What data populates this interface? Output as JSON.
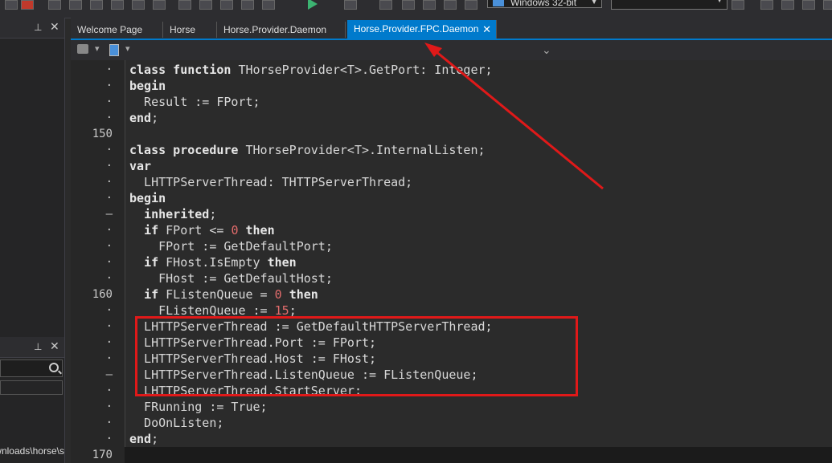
{
  "toolbar": {
    "platform_value": "Windows 32-bit",
    "config_value": ""
  },
  "left_panel": {
    "path_text": "C:\\Users\\...\\Downloads\\horse\\s"
  },
  "tabs": [
    {
      "label": "Welcome Page",
      "active": false
    },
    {
      "label": "Horse",
      "active": false
    },
    {
      "label": "Horse.Provider.Daemon",
      "active": false
    },
    {
      "label": "Horse.Provider.FPC.Daemon",
      "active": true
    }
  ],
  "gutter": [
    {
      "text": "·"
    },
    {
      "text": "·"
    },
    {
      "text": "·"
    },
    {
      "text": "·"
    },
    {
      "text": "150"
    },
    {
      "text": "·"
    },
    {
      "text": "·"
    },
    {
      "text": "·"
    },
    {
      "text": "·"
    },
    {
      "text": "–"
    },
    {
      "text": "·"
    },
    {
      "text": "·"
    },
    {
      "text": "·"
    },
    {
      "text": "·"
    },
    {
      "text": "160"
    },
    {
      "text": "·"
    },
    {
      "text": "·"
    },
    {
      "text": "·"
    },
    {
      "text": "·"
    },
    {
      "text": "–"
    },
    {
      "text": "·"
    },
    {
      "text": "·"
    },
    {
      "text": "·"
    },
    {
      "text": "·"
    },
    {
      "text": "170"
    }
  ],
  "code_lines": [
    [
      {
        "t": "class function",
        "k": "kw"
      },
      {
        "t": " THorseProvider<T>.GetPort: Integer;"
      }
    ],
    [
      {
        "t": "begin",
        "k": "kw"
      }
    ],
    [
      {
        "t": "  Result := FPort;"
      }
    ],
    [
      {
        "t": "end",
        "k": "kw"
      },
      {
        "t": ";"
      }
    ],
    [
      {
        "t": ""
      }
    ],
    [
      {
        "t": "class procedure",
        "k": "kw"
      },
      {
        "t": " THorseProvider<T>.InternalListen;"
      }
    ],
    [
      {
        "t": "var",
        "k": "kw"
      }
    ],
    [
      {
        "t": "  LHTTPServerThread: THTTPServerThread;"
      }
    ],
    [
      {
        "t": "begin",
        "k": "kw"
      }
    ],
    [
      {
        "t": "  "
      },
      {
        "t": "inherited",
        "k": "kw"
      },
      {
        "t": ";"
      }
    ],
    [
      {
        "t": "  "
      },
      {
        "t": "if",
        "k": "kw"
      },
      {
        "t": " FPort <= "
      },
      {
        "t": "0",
        "k": "num"
      },
      {
        "t": " "
      },
      {
        "t": "then",
        "k": "kw"
      }
    ],
    [
      {
        "t": "    FPort := GetDefaultPort;"
      }
    ],
    [
      {
        "t": "  "
      },
      {
        "t": "if",
        "k": "kw"
      },
      {
        "t": " FHost.IsEmpty "
      },
      {
        "t": "then",
        "k": "kw"
      }
    ],
    [
      {
        "t": "    FHost := GetDefaultHost;"
      }
    ],
    [
      {
        "t": "  "
      },
      {
        "t": "if",
        "k": "kw"
      },
      {
        "t": " FListenQueue = "
      },
      {
        "t": "0",
        "k": "num"
      },
      {
        "t": " "
      },
      {
        "t": "then",
        "k": "kw"
      }
    ],
    [
      {
        "t": "    FListenQueue := "
      },
      {
        "t": "15",
        "k": "num"
      },
      {
        "t": ";"
      }
    ],
    [
      {
        "t": "  LHTTPServerThread := GetDefaultHTTPServerThread;"
      }
    ],
    [
      {
        "t": "  LHTTPServerThread.Port := FPort;"
      }
    ],
    [
      {
        "t": "  LHTTPServerThread.Host := FHost;"
      }
    ],
    [
      {
        "t": "  LHTTPServerThread.ListenQueue := FListenQueue;"
      }
    ],
    [
      {
        "t": "  LHTTPServerThread.StartServer;"
      }
    ],
    [
      {
        "t": "  FRunning := True;"
      }
    ],
    [
      {
        "t": "  DoOnListen;"
      }
    ],
    [
      {
        "t": "end",
        "k": "kw"
      },
      {
        "t": ";"
      }
    ]
  ],
  "annotation": {
    "highlight_color": "#e01919"
  }
}
